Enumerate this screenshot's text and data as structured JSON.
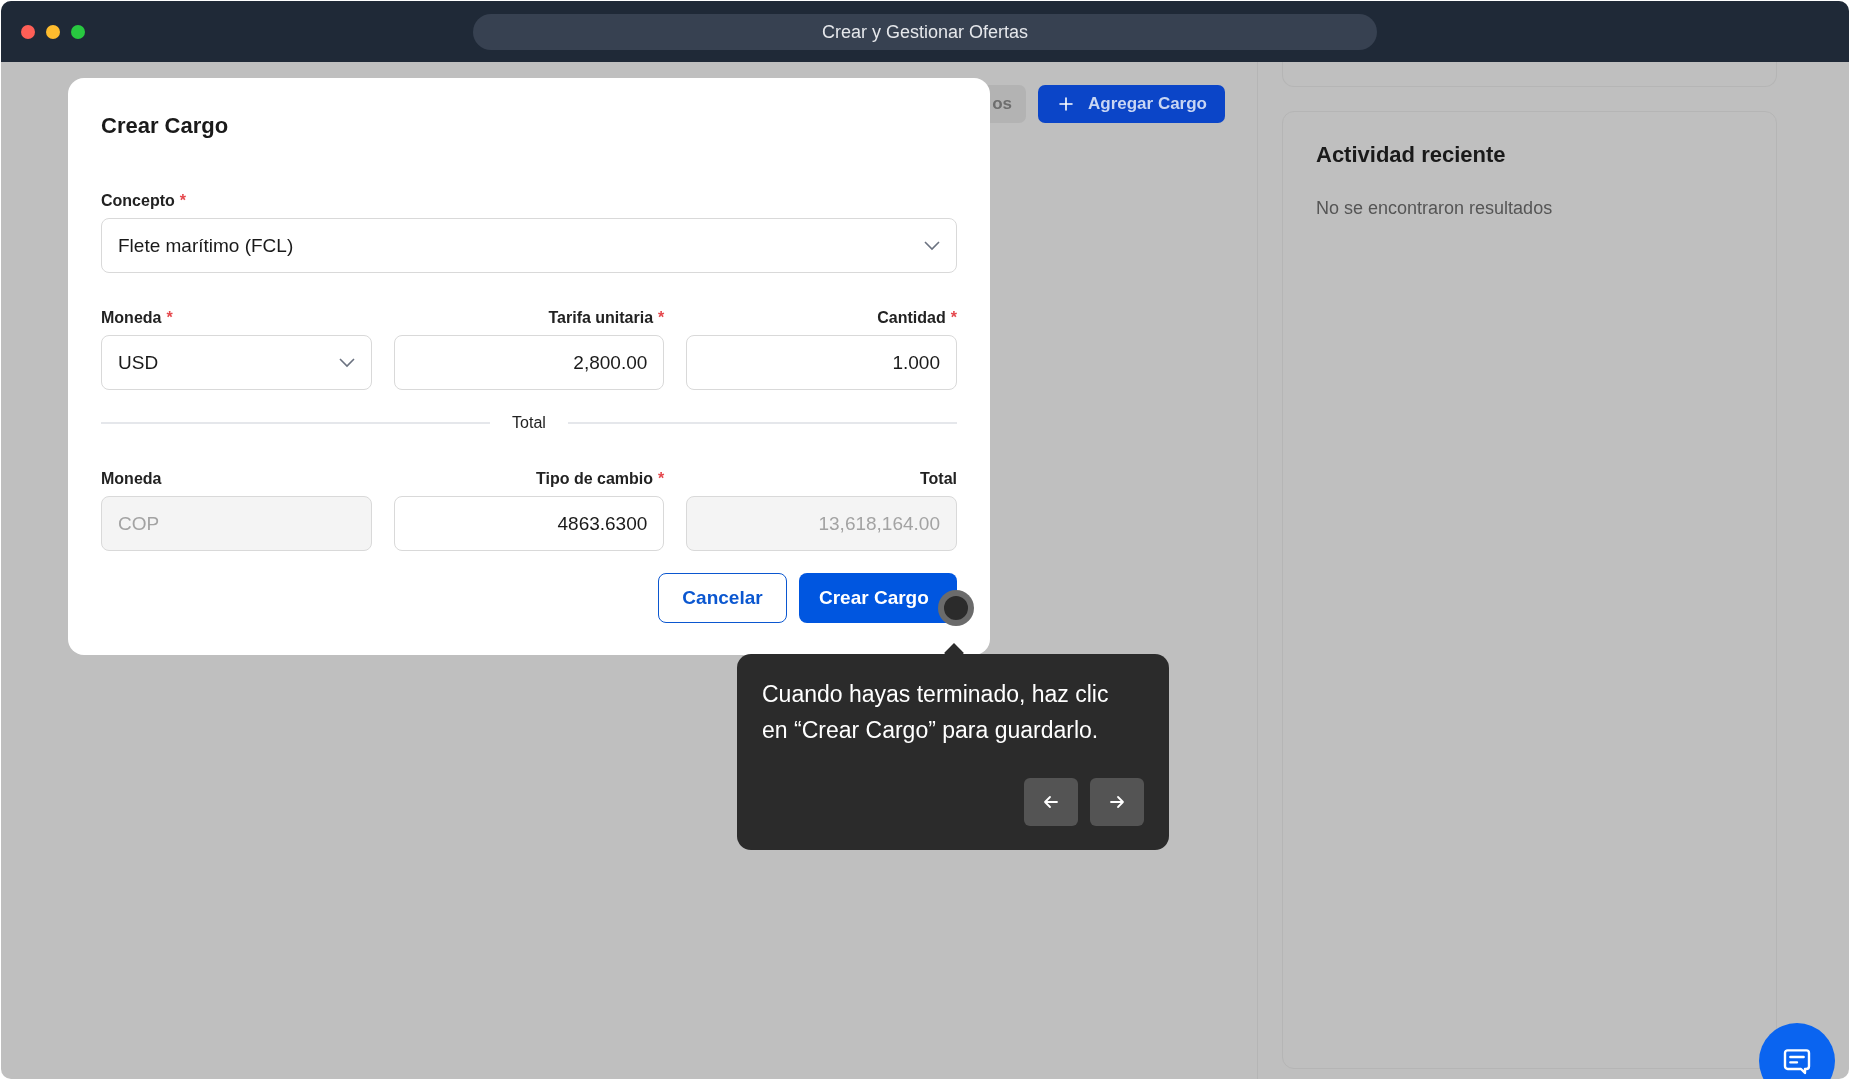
{
  "window": {
    "title": "Crear y Gestionar Ofertas"
  },
  "toolbar": {
    "buttons": [
      {
        "label": "os",
        "kind": "secondary"
      },
      {
        "label": "Agregar Cargo",
        "kind": "primary"
      }
    ]
  },
  "activity": {
    "title": "Actividad reciente",
    "empty_text": "No se encontraron resultados"
  },
  "modal": {
    "title": "Crear Cargo",
    "required_mark": "*",
    "concept": {
      "label": "Concepto",
      "required": true,
      "value": "Flete marítimo (FCL)"
    },
    "row_1": [
      {
        "label": "Moneda",
        "required": true,
        "value": "USD",
        "kind": "select",
        "disabled": false
      },
      {
        "label": "Tarifa unitaria",
        "required": true,
        "value": "2,800.00",
        "kind": "number",
        "disabled": false
      },
      {
        "label": "Cantidad",
        "required": true,
        "value": "1.000",
        "kind": "number",
        "disabled": false
      }
    ],
    "divider_label": "Total",
    "row_2": [
      {
        "label": "Moneda",
        "required": false,
        "value": "COP",
        "kind": "text",
        "disabled": true
      },
      {
        "label": "Tipo de cambio",
        "required": true,
        "value": "4863.6300",
        "kind": "number",
        "disabled": false
      },
      {
        "label": "Total",
        "required": false,
        "value": "13,618,164.00",
        "kind": "number",
        "disabled": true
      }
    ],
    "buttons": [
      {
        "label": "Cancelar",
        "kind": "secondary"
      },
      {
        "label": "Crear Cargo",
        "kind": "primary"
      }
    ]
  },
  "tour": {
    "text": "Cuando hayas terminado, haz clic en “Crear Cargo” para guardarlo."
  }
}
